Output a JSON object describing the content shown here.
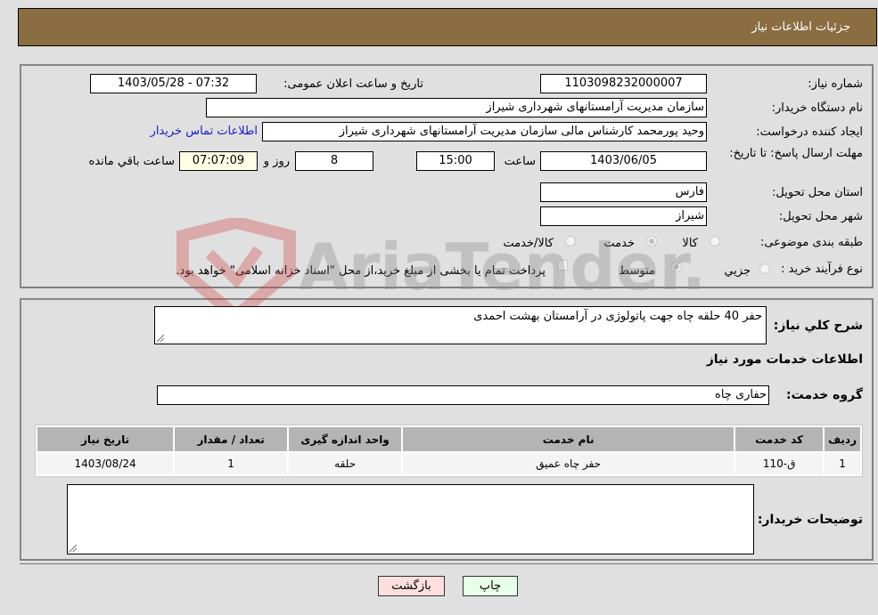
{
  "header": {
    "title": "جزئیات اطلاعات نیاز"
  },
  "form": {
    "need_number_label": "شماره نیاز:",
    "need_number": "1103098232000007",
    "announce_label": "تاریخ و ساعت اعلان عمومی:",
    "announce_value": "1403/05/28 - 07:32",
    "buyer_org_label": "نام دستگاه خریدار:",
    "buyer_org": "سازمان مدیریت آرامستانهای شهرداری شیراز",
    "creator_label": "ایجاد کننده درخواست:",
    "creator": "وحید پورمحمد کارشناس مالی سازمان مدیریت آرامستانهای شهرداری شیراز",
    "contact_link": "اطلاعات تماس خریدار",
    "deadline_label": "مهلت ارسال پاسخ: تا تاریخ:",
    "deadline_date": "1403/06/05",
    "time_label": "ساعت",
    "deadline_time": "15:00",
    "days_value": "8",
    "days_label": "روز و",
    "remaining_time": "07:07:09",
    "remaining_label": "ساعت باقي مانده",
    "province_label": "استان محل تحویل:",
    "province": "فارس",
    "city_label": "شهر محل تحویل:",
    "city": "شیراز",
    "category_label": "طبقه بندی موضوعی:",
    "category_options": [
      {
        "label": "کالا",
        "checked": false
      },
      {
        "label": "خدمت",
        "checked": true
      },
      {
        "label": "کالا/خدمت",
        "checked": false
      }
    ],
    "process_label": "نوع فرآیند خرید :",
    "process_options": [
      {
        "label": "جزيي",
        "checked": false
      },
      {
        "label": "متوسط",
        "checked": true
      }
    ],
    "treasury_note": "پرداخت تمام یا بخشی از مبلغ خرید،از محل \"اسناد خزانه اسلامی\" خواهد بود."
  },
  "details": {
    "summary_label": "شرح كلي نياز:",
    "summary": "حفر 40 حلقه چاه جهت پاتولوژی در آرامستان بهشت احمدی",
    "services_heading": "اطلاعات خدمات مورد نياز",
    "service_group_label": "گروه خدمت:",
    "service_group": "حفاری چاه",
    "table": {
      "headers": [
        "ردیف",
        "کد خدمت",
        "نام خدمت",
        "واحد اندازه گیری",
        "تعداد / مقدار",
        "تاریخ نیاز"
      ],
      "rows": [
        [
          "1",
          "ق-110",
          "حفر چاه عمیق",
          "حلقه",
          "1",
          "1403/08/24"
        ]
      ]
    },
    "buyer_notes_label": "توضیحات خریدار:",
    "buyer_notes": ""
  },
  "buttons": {
    "print": "چاپ",
    "back": "بازگشت"
  },
  "watermark": {
    "text": "AriaTender.neT"
  },
  "colors": {
    "header": "#8b6d42",
    "back_button": "#ffdede",
    "print_button": "#e8ffe8",
    "link": "#1a1acc"
  }
}
